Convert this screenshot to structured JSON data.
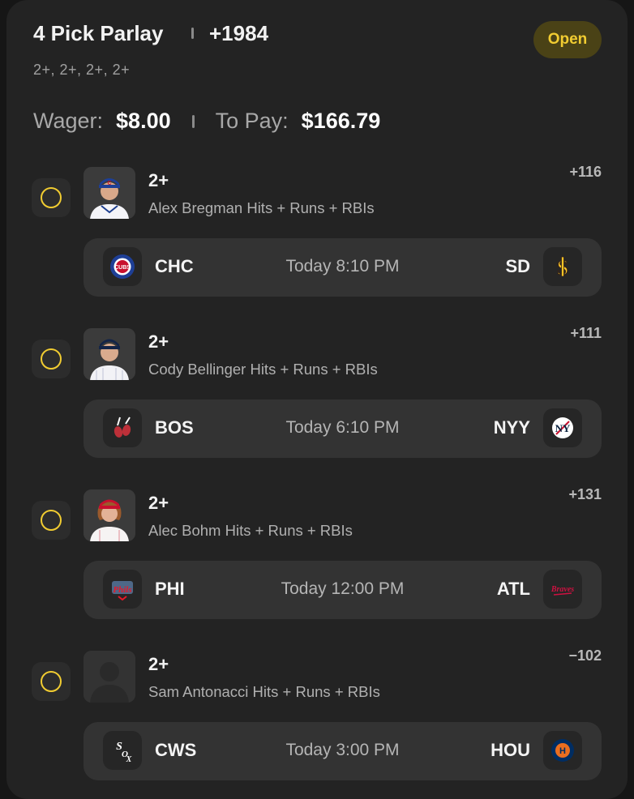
{
  "header": {
    "title": "4 Pick Parlay",
    "odds": "+1984",
    "status": "Open",
    "subline": "2+, 2+, 2+, 2+"
  },
  "wager": {
    "wager_label": "Wager:",
    "wager_value": "$8.00",
    "topay_label": "To Pay:",
    "topay_value": "$166.79"
  },
  "picks": [
    {
      "line": "2+",
      "market": "Alex Bregman Hits + Runs + RBIs",
      "odds": "+116",
      "game": {
        "away": "CHC",
        "time": "Today 8:10 PM",
        "home": "SD"
      }
    },
    {
      "line": "2+",
      "market": "Cody Bellinger Hits + Runs + RBIs",
      "odds": "+111",
      "game": {
        "away": "BOS",
        "time": "Today 6:10 PM",
        "home": "NYY"
      }
    },
    {
      "line": "2+",
      "market": "Alec Bohm Hits + Runs + RBIs",
      "odds": "+131",
      "game": {
        "away": "PHI",
        "time": "Today 12:00 PM",
        "home": "ATL"
      }
    },
    {
      "line": "2+",
      "market": "Sam Antonacci Hits + Runs + RBIs",
      "odds": "−102",
      "game": {
        "away": "CWS",
        "time": "Today 3:00 PM",
        "home": "HOU"
      }
    }
  ],
  "colors": {
    "accent": "#f1cc31",
    "card": "#232323",
    "game_bar": "#333333"
  }
}
